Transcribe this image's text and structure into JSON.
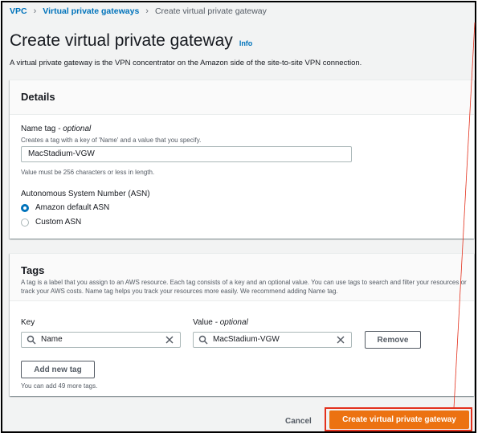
{
  "breadcrumb": {
    "items": [
      "VPC",
      "Virtual private gateways"
    ],
    "current": "Create virtual private gateway"
  },
  "page": {
    "title": "Create virtual private gateway",
    "info": "Info",
    "description": "A virtual private gateway is the VPN concentrator on the Amazon side of the site-to-site VPN connection."
  },
  "details": {
    "heading": "Details",
    "name_tag_label": "Name tag",
    "optional": "- optional",
    "name_tag_hint": "Creates a tag with a key of 'Name' and a value that you specify.",
    "name_tag_value": "MacStadium-VGW",
    "name_tag_constraint": "Value must be 256 characters or less in length.",
    "asn_label": "Autonomous System Number (ASN)",
    "asn_options": [
      "Amazon default ASN",
      "Custom ASN"
    ],
    "asn_selected": "Amazon default ASN"
  },
  "tags": {
    "heading": "Tags",
    "description": "A tag is a label that you assign to an AWS resource. Each tag consists of a key and an optional value. You can use tags to search and filter your resources or track your AWS costs. Name tag helps you track your resources more easily. We recommend adding Name tag.",
    "key_label": "Key",
    "value_label": "Value",
    "value_optional": "- optional",
    "key_value": "Name",
    "value_value": "MacStadium-VGW",
    "remove_label": "Remove",
    "add_label": "Add new tag",
    "limit_text": "You can add 49 more tags."
  },
  "footer": {
    "cancel_label": "Cancel",
    "create_label": "Create virtual private gateway"
  },
  "colors": {
    "link": "#0073bb",
    "primary": "#ec7211",
    "highlight": "#e3301c"
  }
}
